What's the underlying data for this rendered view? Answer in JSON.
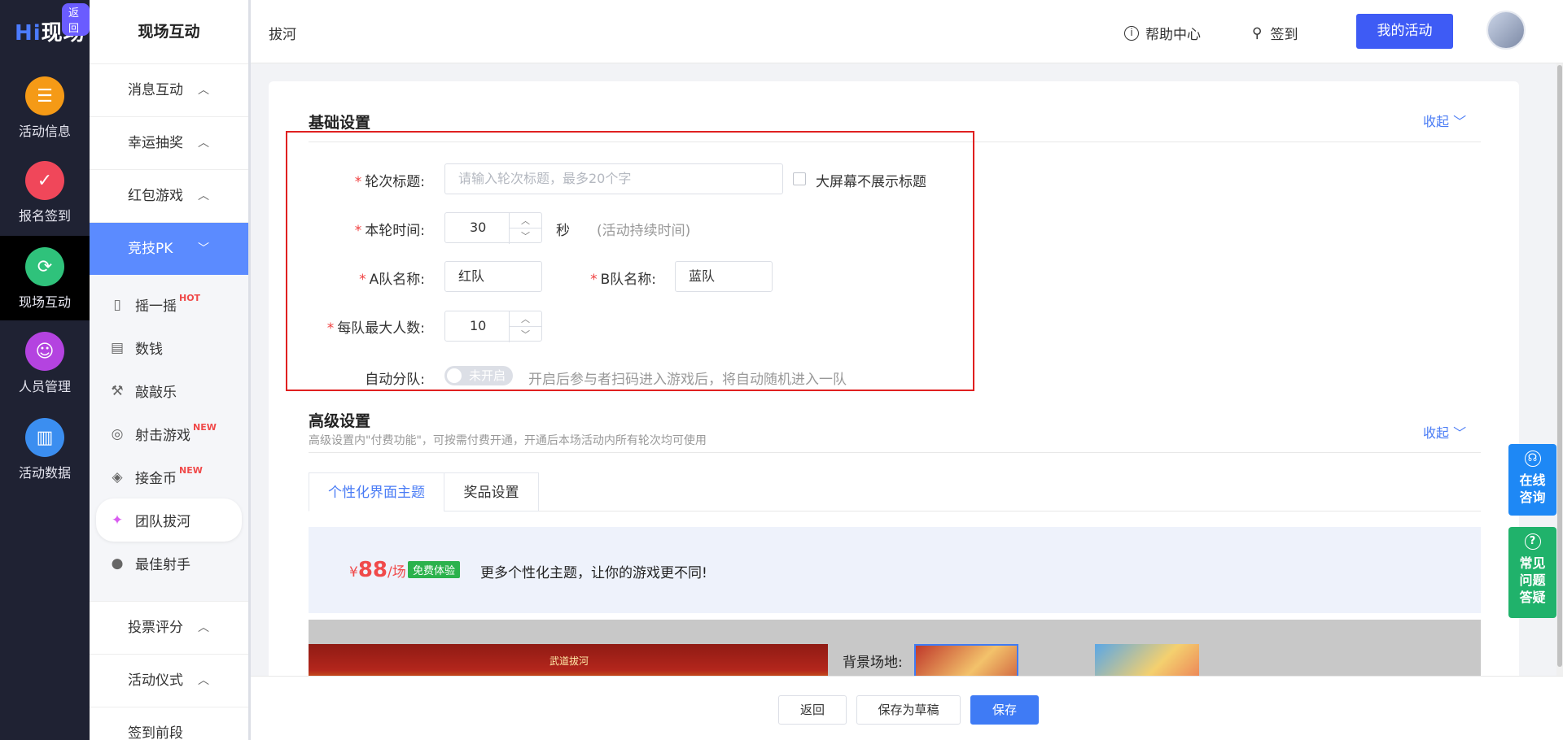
{
  "rail": {
    "logo": "Hi现场",
    "logo_hi": "Hi",
    "logo_rest": "现场",
    "back_badge": "返回",
    "items": [
      {
        "label": "活动信息",
        "icon": "document-icon",
        "color": "#f59a16"
      },
      {
        "label": "报名签到",
        "icon": "calendar-check-icon",
        "color": "#f0475a"
      },
      {
        "label": "现场互动",
        "icon": "interaction-icon",
        "color": "#2fc27b"
      },
      {
        "label": "人员管理",
        "icon": "person-card-icon",
        "color": "#b443e0"
      },
      {
        "label": "活动数据",
        "icon": "bar-chart-icon",
        "color": "#3b8ef0"
      }
    ]
  },
  "sidebar": {
    "title": "现场互动",
    "categories": [
      {
        "label": "消息互动"
      },
      {
        "label": "幸运抽奖"
      },
      {
        "label": "红包游戏"
      },
      {
        "label": "竞技PK"
      }
    ],
    "sub_items": [
      {
        "label": "摇一摇",
        "badge": "HOT",
        "icon": "phone-shake-icon"
      },
      {
        "label": "数钱",
        "badge": "",
        "icon": "money-icon"
      },
      {
        "label": "敲敲乐",
        "badge": "",
        "icon": "hammer-icon"
      },
      {
        "label": "射击游戏",
        "badge": "NEW",
        "icon": "target-icon"
      },
      {
        "label": "接金币",
        "badge": "NEW",
        "icon": "coin-stack-icon"
      },
      {
        "label": "团队拔河",
        "badge": "",
        "icon": "tug-of-war-icon"
      },
      {
        "label": "最佳射手",
        "badge": "",
        "icon": "ball-icon"
      }
    ],
    "lower_categories": [
      {
        "label": "投票评分"
      },
      {
        "label": "活动仪式"
      },
      {
        "label": "签到前段"
      }
    ]
  },
  "header": {
    "breadcrumb": "拔河",
    "help_center": "帮助中心",
    "checkin": "签到",
    "my_activity": "我的活动"
  },
  "basic": {
    "title": "基础设置",
    "collapse": "收起",
    "round_title_label": "轮次标题:",
    "round_title_placeholder": "请输入轮次标题，最多20个字",
    "hide_title_label": "大屏幕不展示标题",
    "round_time_label": "本轮时间:",
    "round_time_value": "30",
    "round_time_unit": "秒",
    "round_time_hint": "(活动持续时间)",
    "team_a_label": "A队名称:",
    "team_a_value": "红队",
    "team_b_label": "B队名称:",
    "team_b_value": "蓝队",
    "max_members_label": "每队最大人数:",
    "max_members_value": "10",
    "auto_team_label": "自动分队:",
    "auto_team_toggle": "未开启",
    "auto_team_hint": "开启后参与者扫码进入游戏后，将自动随机进入一队"
  },
  "advanced": {
    "title": "高级设置",
    "collapse": "收起",
    "subtitle": "高级设置内\"付费功能\"，可按需付费开通，开通后本场活动内所有轮次均可使用",
    "tabs": [
      "个性化界面主题",
      "奖品设置"
    ],
    "price_currency": "¥",
    "price_value": "88",
    "price_unit": "/场",
    "free_badge": "免费体验",
    "promo_text": "更多个性化主题，让你的游戏更不同!",
    "preview_caption": "武道拔河",
    "background_label": "背景场地:"
  },
  "footer": {
    "back": "返回",
    "save_draft": "保存为草稿",
    "save": "保存"
  },
  "floats": {
    "online": "在线咨询",
    "online_lines": [
      "在线",
      "咨询"
    ],
    "faq_lines": [
      "常见",
      "问题",
      "答疑"
    ]
  },
  "colors": {
    "primary": "#3e5bf5",
    "sidebar_active": "#5b8bff",
    "online_float": "#1e88f5",
    "faq_float": "#20b26b",
    "highlight_box": "#e02020"
  }
}
